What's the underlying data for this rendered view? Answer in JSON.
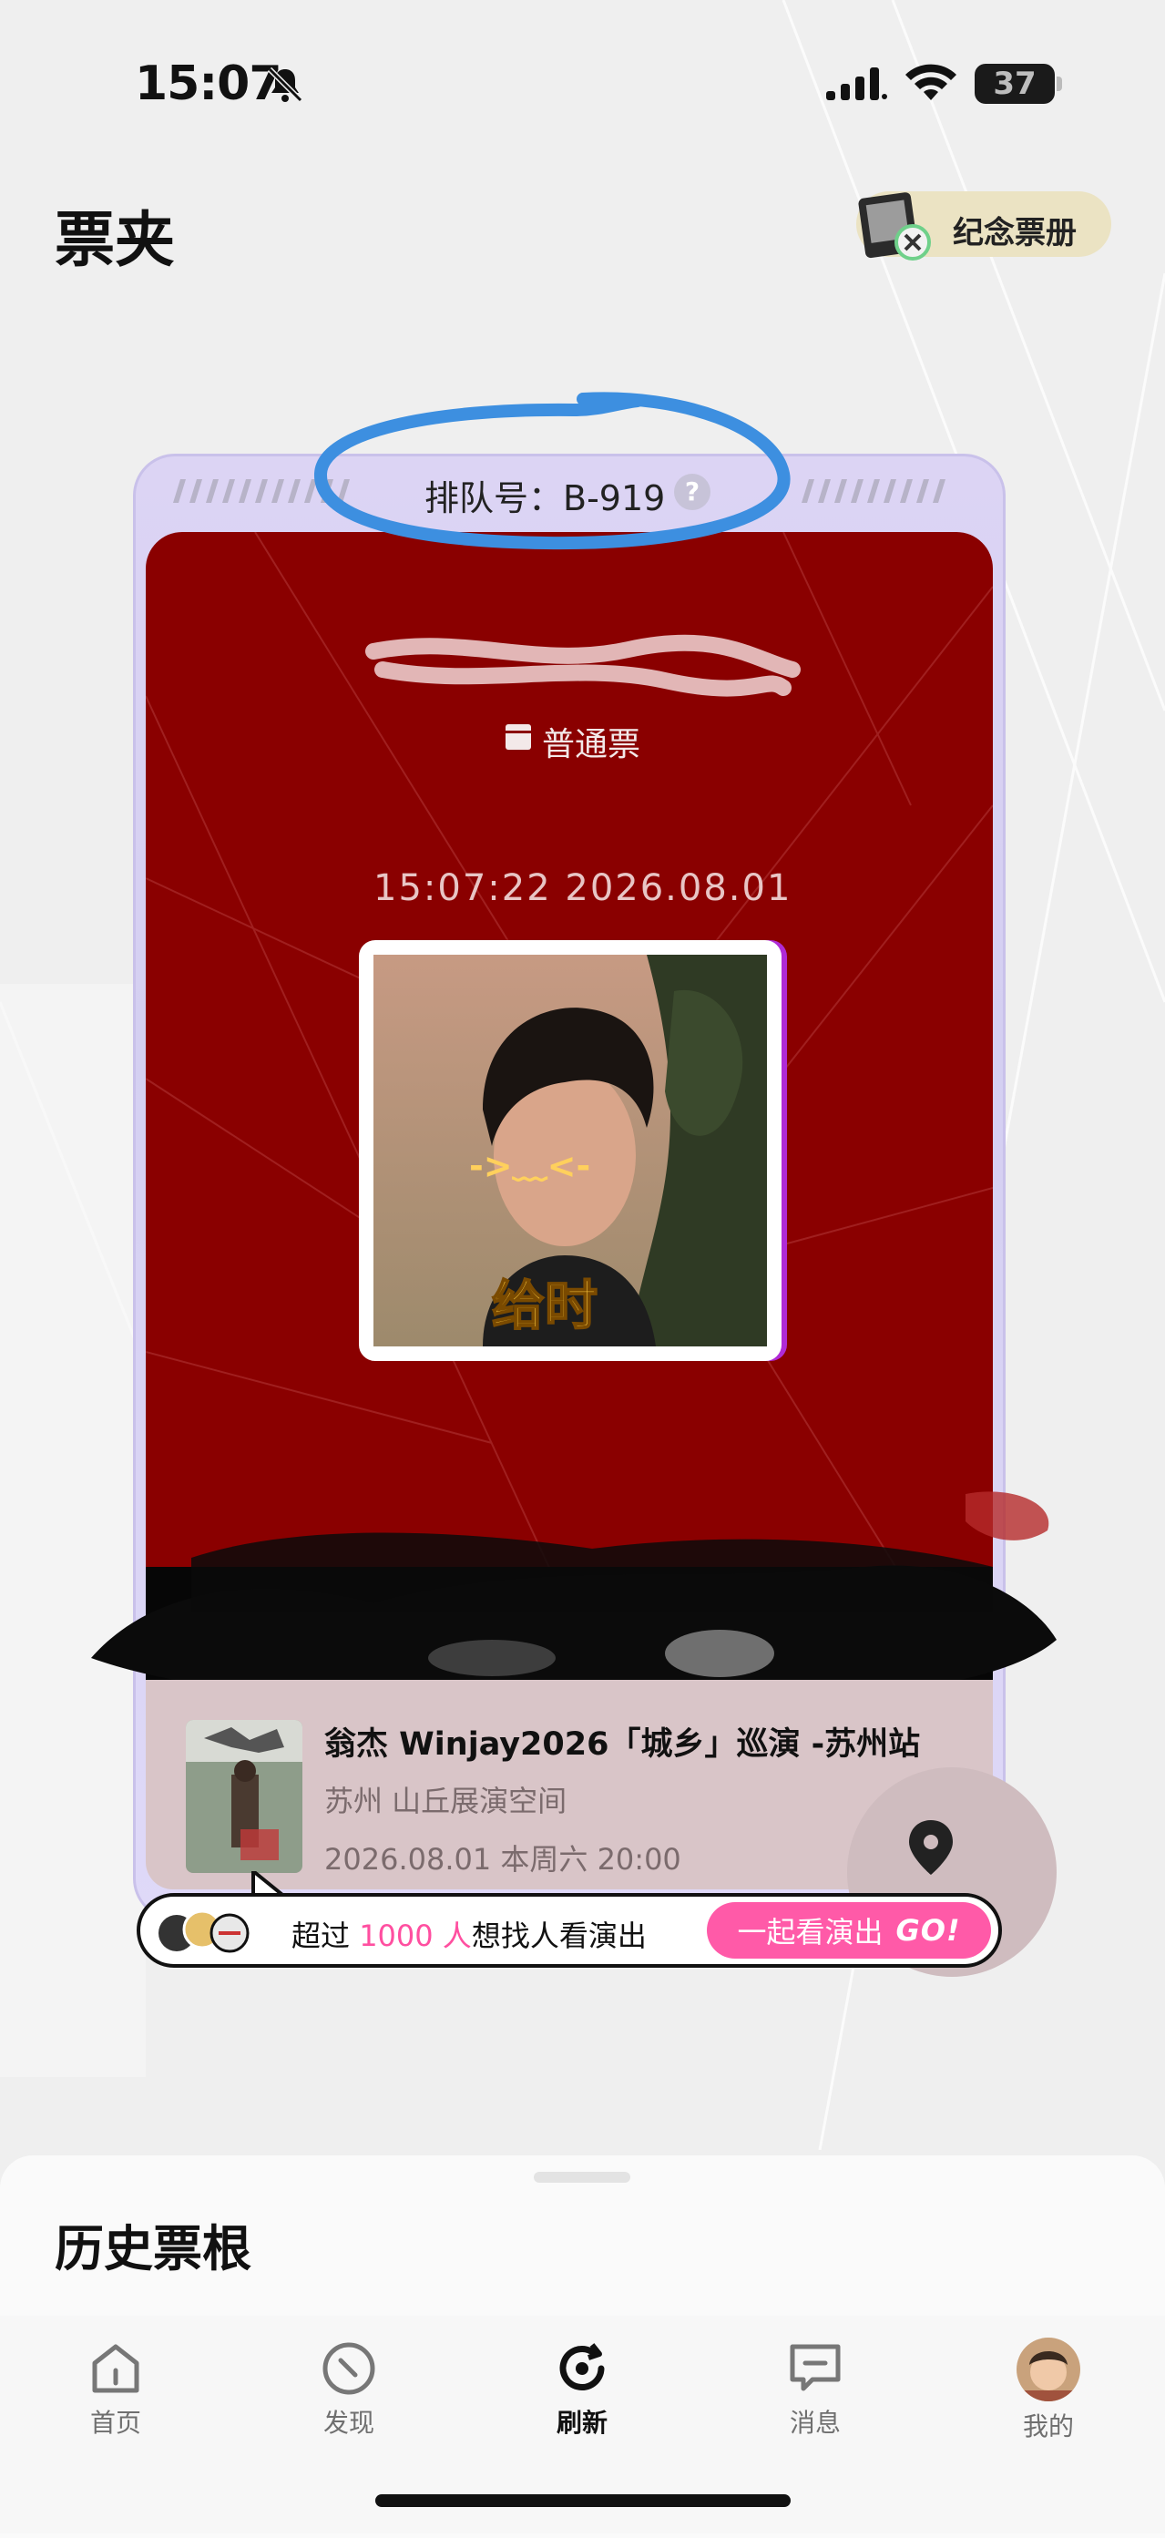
{
  "status_bar": {
    "time": "15:07",
    "battery": "37"
  },
  "header": {
    "title": "票夹",
    "souvenir_label": "纪念票册"
  },
  "ticket": {
    "queue_label": "排队号：",
    "queue_number": "B-919",
    "help_mark": "?",
    "type_label": "普通票",
    "timestamp": "15:07:22  2026.08.01",
    "photo_overlay_text": "给时",
    "event": {
      "title": "翁杰 Winjay2026「城乡」巡演 -苏州站",
      "venue": "苏州 山丘展演空间",
      "datetime": "2026.08.01 本周六 20:00"
    }
  },
  "invite": {
    "prefix": "超过 ",
    "count": "1000 人",
    "suffix": "想找人看演出",
    "button_label": "一起看演出",
    "button_go": "GO!"
  },
  "history": {
    "title": "历史票根"
  },
  "tabs": [
    {
      "label": "首页",
      "icon": "home-icon"
    },
    {
      "label": "发现",
      "icon": "compass-icon"
    },
    {
      "label": "刷新",
      "icon": "refresh-icon",
      "active": true
    },
    {
      "label": "消息",
      "icon": "message-icon"
    },
    {
      "label": "我的",
      "icon": "profile-avatar"
    }
  ],
  "colors": {
    "ticket_red": "#8a0000",
    "highlight_pink": "#ff4fa0",
    "annotation_blue": "#3d8fe0",
    "souvenir_bg": "#ebe3c3"
  }
}
